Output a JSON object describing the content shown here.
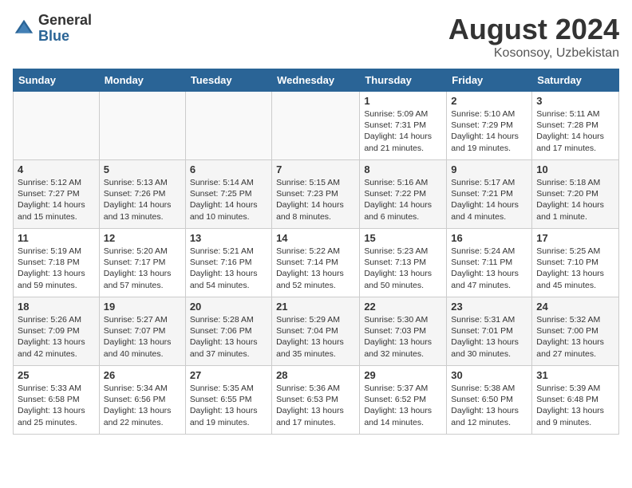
{
  "header": {
    "logo_general": "General",
    "logo_blue": "Blue",
    "main_title": "August 2024",
    "subtitle": "Kosonsoy, Uzbekistan"
  },
  "days_of_week": [
    "Sunday",
    "Monday",
    "Tuesday",
    "Wednesday",
    "Thursday",
    "Friday",
    "Saturday"
  ],
  "weeks": [
    [
      {
        "day": "",
        "info": ""
      },
      {
        "day": "",
        "info": ""
      },
      {
        "day": "",
        "info": ""
      },
      {
        "day": "",
        "info": ""
      },
      {
        "day": "1",
        "info": "Sunrise: 5:09 AM\nSunset: 7:31 PM\nDaylight: 14 hours\nand 21 minutes."
      },
      {
        "day": "2",
        "info": "Sunrise: 5:10 AM\nSunset: 7:29 PM\nDaylight: 14 hours\nand 19 minutes."
      },
      {
        "day": "3",
        "info": "Sunrise: 5:11 AM\nSunset: 7:28 PM\nDaylight: 14 hours\nand 17 minutes."
      }
    ],
    [
      {
        "day": "4",
        "info": "Sunrise: 5:12 AM\nSunset: 7:27 PM\nDaylight: 14 hours\nand 15 minutes."
      },
      {
        "day": "5",
        "info": "Sunrise: 5:13 AM\nSunset: 7:26 PM\nDaylight: 14 hours\nand 13 minutes."
      },
      {
        "day": "6",
        "info": "Sunrise: 5:14 AM\nSunset: 7:25 PM\nDaylight: 14 hours\nand 10 minutes."
      },
      {
        "day": "7",
        "info": "Sunrise: 5:15 AM\nSunset: 7:23 PM\nDaylight: 14 hours\nand 8 minutes."
      },
      {
        "day": "8",
        "info": "Sunrise: 5:16 AM\nSunset: 7:22 PM\nDaylight: 14 hours\nand 6 minutes."
      },
      {
        "day": "9",
        "info": "Sunrise: 5:17 AM\nSunset: 7:21 PM\nDaylight: 14 hours\nand 4 minutes."
      },
      {
        "day": "10",
        "info": "Sunrise: 5:18 AM\nSunset: 7:20 PM\nDaylight: 14 hours\nand 1 minute."
      }
    ],
    [
      {
        "day": "11",
        "info": "Sunrise: 5:19 AM\nSunset: 7:18 PM\nDaylight: 13 hours\nand 59 minutes."
      },
      {
        "day": "12",
        "info": "Sunrise: 5:20 AM\nSunset: 7:17 PM\nDaylight: 13 hours\nand 57 minutes."
      },
      {
        "day": "13",
        "info": "Sunrise: 5:21 AM\nSunset: 7:16 PM\nDaylight: 13 hours\nand 54 minutes."
      },
      {
        "day": "14",
        "info": "Sunrise: 5:22 AM\nSunset: 7:14 PM\nDaylight: 13 hours\nand 52 minutes."
      },
      {
        "day": "15",
        "info": "Sunrise: 5:23 AM\nSunset: 7:13 PM\nDaylight: 13 hours\nand 50 minutes."
      },
      {
        "day": "16",
        "info": "Sunrise: 5:24 AM\nSunset: 7:11 PM\nDaylight: 13 hours\nand 47 minutes."
      },
      {
        "day": "17",
        "info": "Sunrise: 5:25 AM\nSunset: 7:10 PM\nDaylight: 13 hours\nand 45 minutes."
      }
    ],
    [
      {
        "day": "18",
        "info": "Sunrise: 5:26 AM\nSunset: 7:09 PM\nDaylight: 13 hours\nand 42 minutes."
      },
      {
        "day": "19",
        "info": "Sunrise: 5:27 AM\nSunset: 7:07 PM\nDaylight: 13 hours\nand 40 minutes."
      },
      {
        "day": "20",
        "info": "Sunrise: 5:28 AM\nSunset: 7:06 PM\nDaylight: 13 hours\nand 37 minutes."
      },
      {
        "day": "21",
        "info": "Sunrise: 5:29 AM\nSunset: 7:04 PM\nDaylight: 13 hours\nand 35 minutes."
      },
      {
        "day": "22",
        "info": "Sunrise: 5:30 AM\nSunset: 7:03 PM\nDaylight: 13 hours\nand 32 minutes."
      },
      {
        "day": "23",
        "info": "Sunrise: 5:31 AM\nSunset: 7:01 PM\nDaylight: 13 hours\nand 30 minutes."
      },
      {
        "day": "24",
        "info": "Sunrise: 5:32 AM\nSunset: 7:00 PM\nDaylight: 13 hours\nand 27 minutes."
      }
    ],
    [
      {
        "day": "25",
        "info": "Sunrise: 5:33 AM\nSunset: 6:58 PM\nDaylight: 13 hours\nand 25 minutes."
      },
      {
        "day": "26",
        "info": "Sunrise: 5:34 AM\nSunset: 6:56 PM\nDaylight: 13 hours\nand 22 minutes."
      },
      {
        "day": "27",
        "info": "Sunrise: 5:35 AM\nSunset: 6:55 PM\nDaylight: 13 hours\nand 19 minutes."
      },
      {
        "day": "28",
        "info": "Sunrise: 5:36 AM\nSunset: 6:53 PM\nDaylight: 13 hours\nand 17 minutes."
      },
      {
        "day": "29",
        "info": "Sunrise: 5:37 AM\nSunset: 6:52 PM\nDaylight: 13 hours\nand 14 minutes."
      },
      {
        "day": "30",
        "info": "Sunrise: 5:38 AM\nSunset: 6:50 PM\nDaylight: 13 hours\nand 12 minutes."
      },
      {
        "day": "31",
        "info": "Sunrise: 5:39 AM\nSunset: 6:48 PM\nDaylight: 13 hours\nand 9 minutes."
      }
    ]
  ]
}
